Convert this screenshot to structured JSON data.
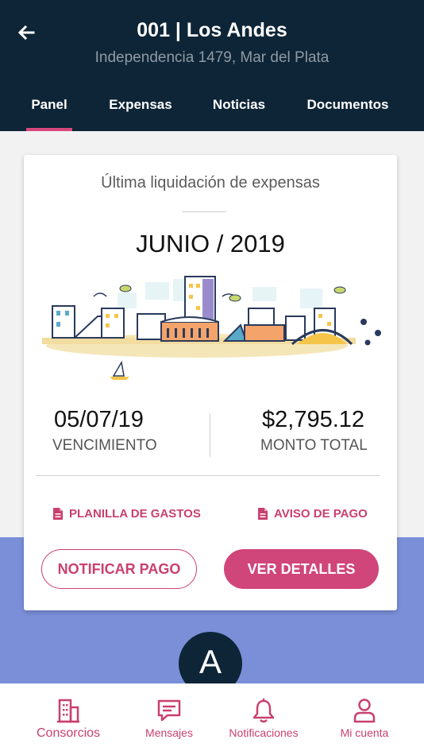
{
  "header": {
    "title": "001 | Los Andes",
    "subtitle": "Independencia 1479,  Mar del Plata",
    "tabs": [
      {
        "label": "Panel"
      },
      {
        "label": "Expensas"
      },
      {
        "label": "Noticias"
      },
      {
        "label": "Documentos"
      }
    ],
    "active_tab": "Panel"
  },
  "card": {
    "heading": "Última liquidación de expensas",
    "period": "JUNIO / 2019",
    "due_date": "05/07/19",
    "due_label": "VENCIMIENTO",
    "amount": "$2,795.12",
    "amount_label": "MONTO TOTAL",
    "link_expenses": "PLANILLA DE GASTOS",
    "link_payment_notice": "AVISO DE PAGO",
    "notify_button": "NOTIFICAR PAGO",
    "details_button": "VER DETALLES"
  },
  "avatar": {
    "initial": "A"
  },
  "bottom_nav": [
    {
      "label": "Consorcios",
      "icon": "building-icon"
    },
    {
      "label": "Mensajes",
      "icon": "chat-icon"
    },
    {
      "label": "Notificaciones",
      "icon": "bell-icon"
    },
    {
      "label": "Mi cuenta",
      "icon": "user-icon"
    }
  ],
  "colors": {
    "header_bg": "#0e2537",
    "accent": "#d0457a",
    "band": "#7a8fd8"
  }
}
